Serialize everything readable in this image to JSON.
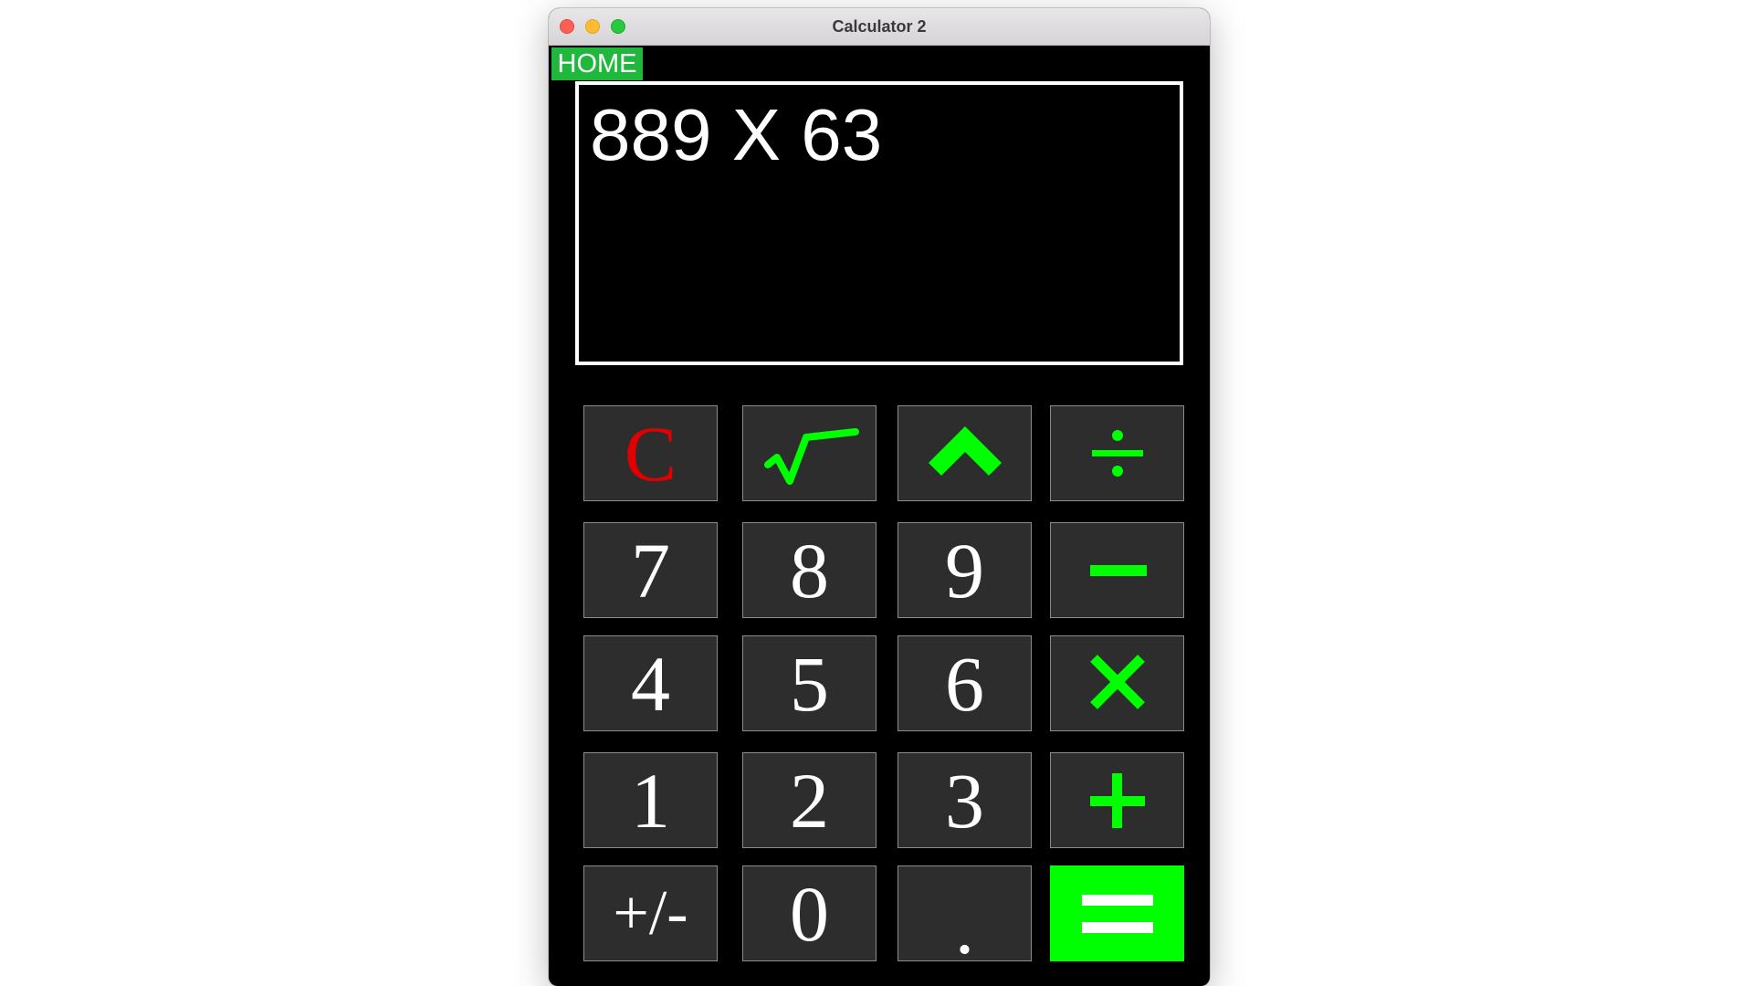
{
  "window": {
    "title": "Calculator 2"
  },
  "home_button": {
    "label": "HOME"
  },
  "display": {
    "expression": "889 X 63"
  },
  "keys": {
    "clear": "C",
    "seven": "7",
    "eight": "8",
    "nine": "9",
    "four": "4",
    "five": "5",
    "six": "6",
    "one": "1",
    "two": "2",
    "three": "3",
    "plus_minus": "+/-",
    "zero": "0",
    "decimal": "."
  },
  "operator_icons": {
    "sqrt": "square-root-icon",
    "power": "caret-up-icon",
    "divide": "divide-icon",
    "subtract": "minus-icon",
    "multiply": "multiply-icon",
    "add": "plus-icon",
    "equals": "equals-icon"
  },
  "colors": {
    "accent_green": "#00ff00",
    "home_green": "#1fb83c",
    "clear_red": "#e00000",
    "key_bg": "#2d2d2d",
    "window_bg": "#000000"
  }
}
